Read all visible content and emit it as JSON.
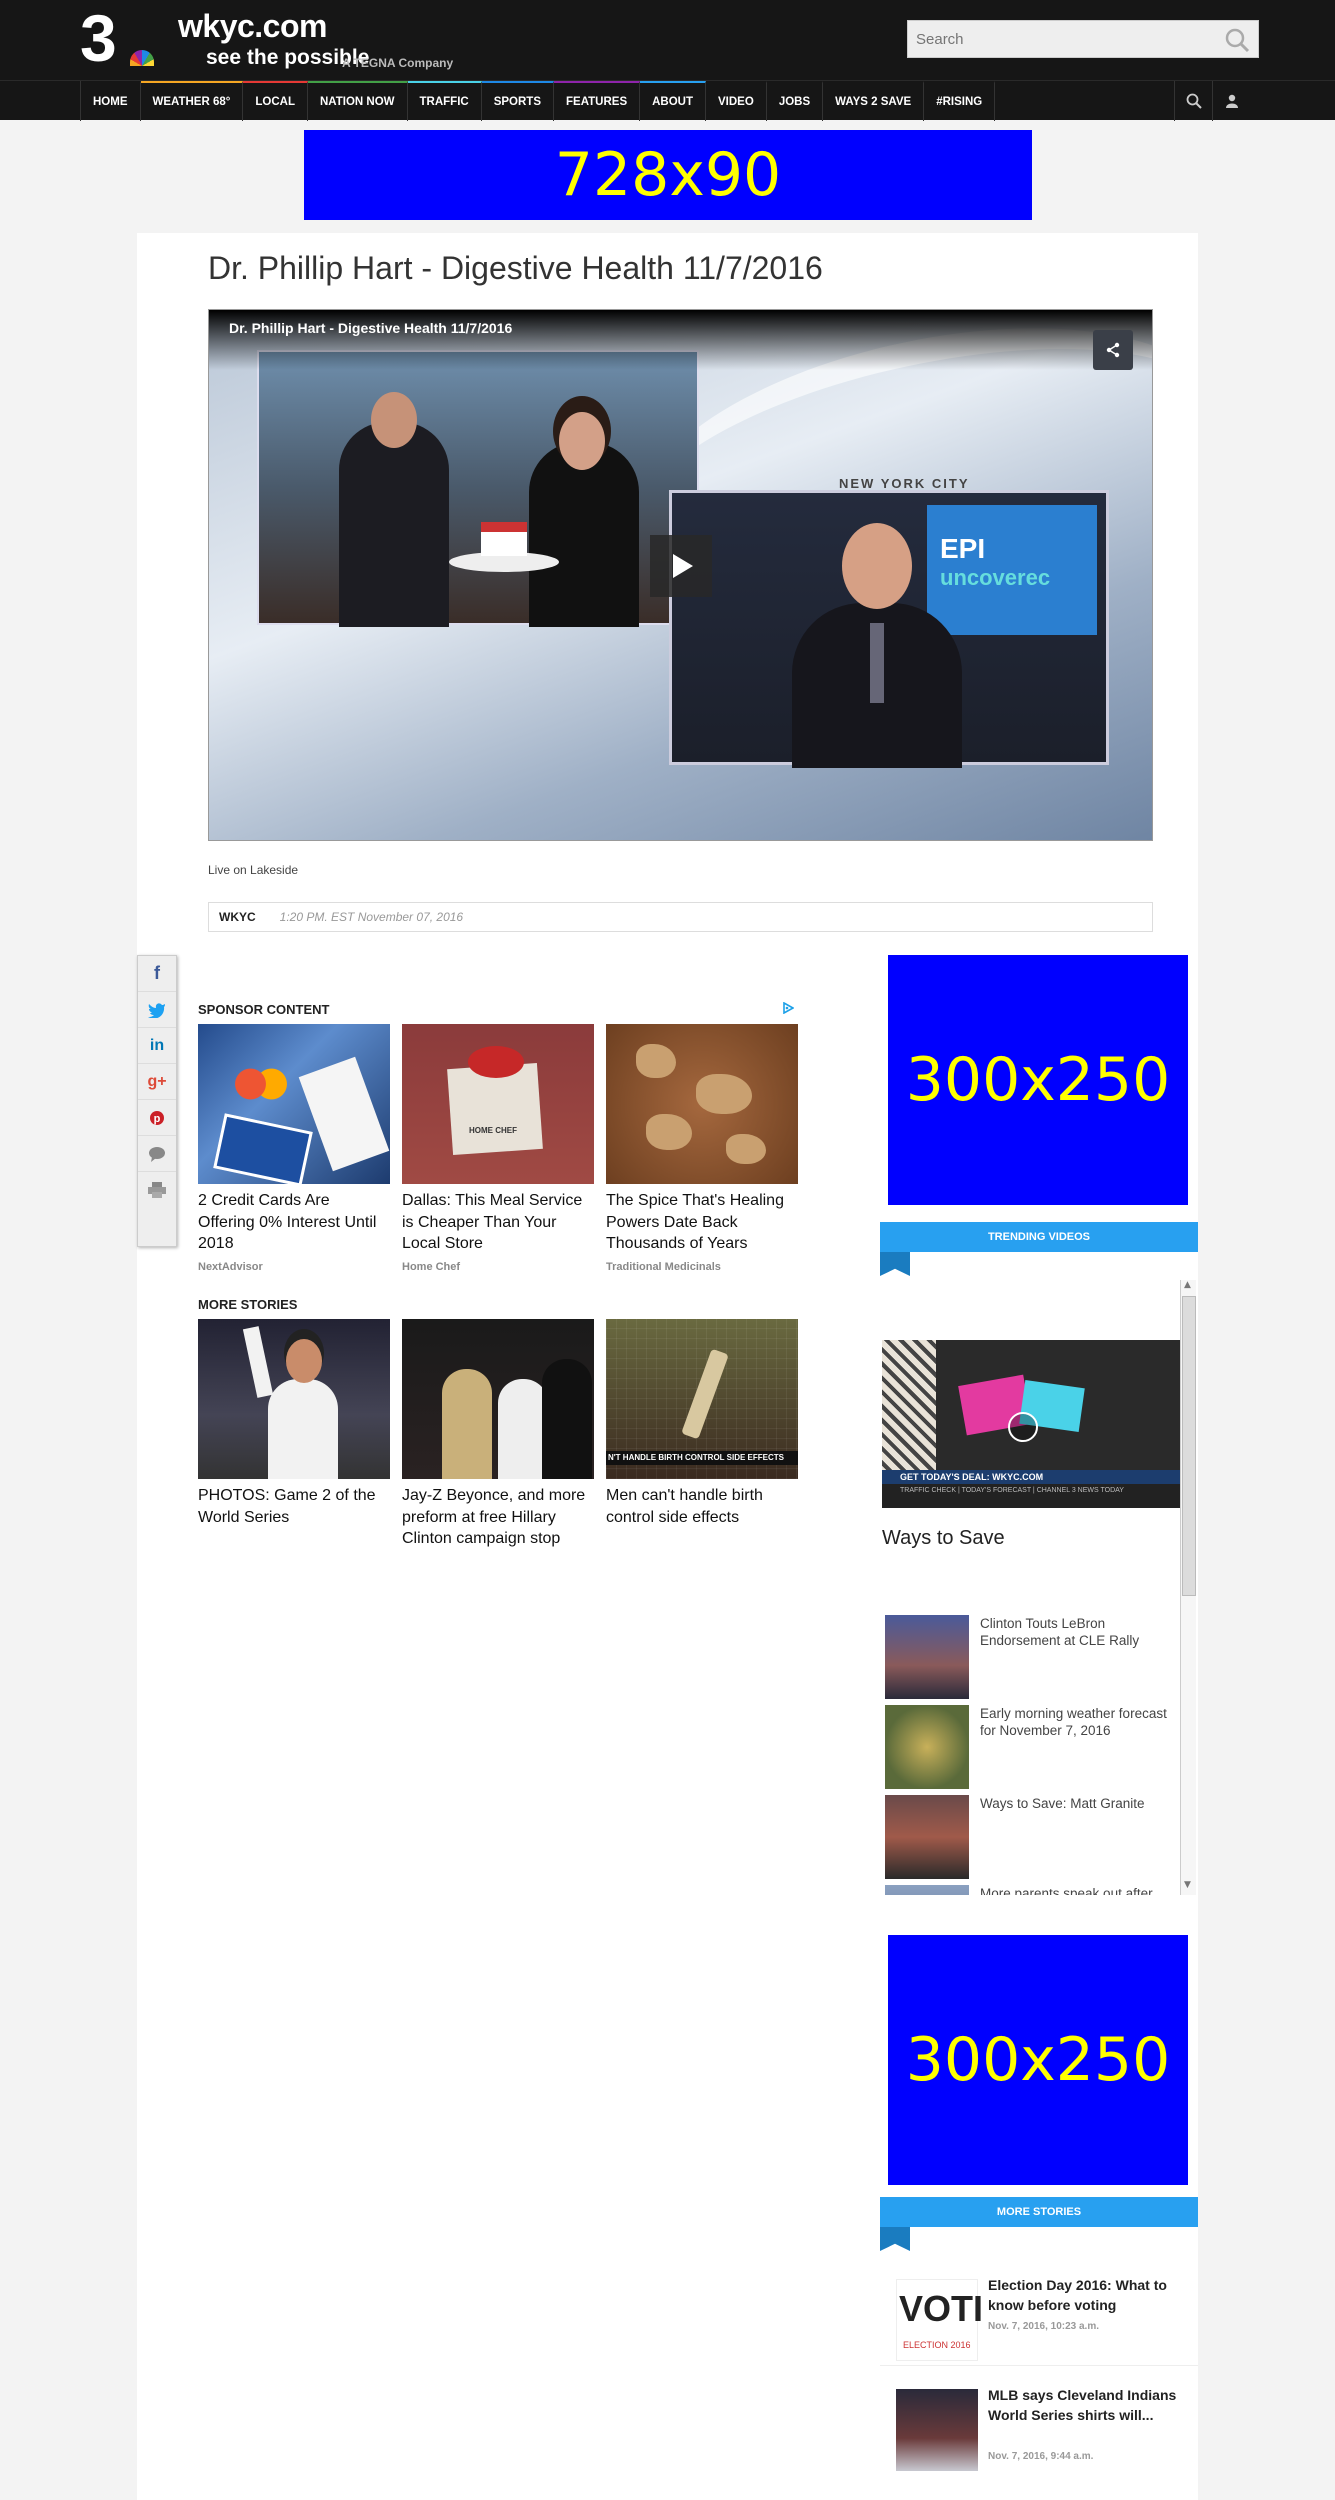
{
  "header": {
    "logo_number": "3",
    "site_name": "wkyc.com",
    "tagline": "see the possible",
    "parent": "A TEGNA Company",
    "search_placeholder": "Search"
  },
  "nav": {
    "items": [
      "HOME",
      "WEATHER 68°",
      "LOCAL",
      "NATION NOW",
      "TRAFFIC",
      "SPORTS",
      "FEATURES",
      "ABOUT",
      "VIDEO",
      "JOBS",
      "WAYS 2 SAVE",
      "#RISING"
    ],
    "accent_colors": [
      "#161616",
      "#f5a623",
      "#e53935",
      "#43a047",
      "#4ad2e8",
      "#1e88e5",
      "#8e24aa",
      "#28a0f0",
      "#161616",
      "#161616",
      "#161616",
      "#161616"
    ]
  },
  "ads": {
    "leaderboard": "728x90",
    "box1": "300x250",
    "box2": "300x250"
  },
  "article": {
    "title": "Dr. Phillip Hart - Digestive Health 11/7/2016",
    "video_title": "Dr. Phillip Hart - Digestive Health 11/7/2016",
    "overlay_text": "NEW YORK CITY",
    "screen_epi": "EPI",
    "screen_unc": "uncoverec",
    "caption": "Live on Lakeside",
    "source": "WKYC",
    "timestamp": "1:20 PM. EST November 07, 2016"
  },
  "social": [
    "f",
    "t",
    "in",
    "g+",
    "p",
    "comment",
    "print"
  ],
  "sponsor": {
    "label": "SPONSOR CONTENT",
    "items": [
      {
        "title": "2 Credit Cards Are Offering 0% Interest Until 2018",
        "source": "NextAdvisor"
      },
      {
        "title": "Dallas: This Meal Service is Cheaper Than Your Local Store",
        "source": "Home Chef",
        "image_text": "HOME CHEF"
      },
      {
        "title": "The Spice That's Healing Powers Date Back Thousands of Years",
        "source": "Traditional Medicinals"
      }
    ]
  },
  "more_stories_main": {
    "label": "MORE STORIES",
    "items": [
      {
        "title": "PHOTOS: Game 2 of the World Series"
      },
      {
        "title": "Jay-Z Beyonce, and more preform at free Hillary Clinton campaign stop"
      },
      {
        "title": "Men can't handle birth control side effects",
        "image_text": "N'T HANDLE BIRTH CONTROL SIDE EFFECTS"
      }
    ]
  },
  "trending": {
    "label": "TRENDING VIDEOS",
    "featured_title": "Ways to Save",
    "featured_banner": "GET TODAY'S DEAL: WKYC.COM",
    "featured_ticker": "TRAFFIC CHECK  |  TODAY'S FORECAST  |  CHANNEL 3 NEWS TODAY",
    "items": [
      {
        "title": "Clinton Touts LeBron Endorsement at CLE Rally"
      },
      {
        "title": "Early morning weather forecast for November 7, 2016"
      },
      {
        "title": "Ways to Save: Matt Granite"
      },
      {
        "title": "More parents speak out after"
      }
    ]
  },
  "sidebar_more": {
    "label": "MORE STORIES",
    "items": [
      {
        "title": "Election Day 2016: What to know before voting",
        "date": "Nov. 7, 2016, 10:23 a.m.",
        "image_text": "VOTI",
        "image_subtext": "ELECTION 2016"
      },
      {
        "title": "MLB says Cleveland Indians World Series shirts will...",
        "date": "Nov. 7, 2016, 9:44 a.m."
      }
    ]
  }
}
